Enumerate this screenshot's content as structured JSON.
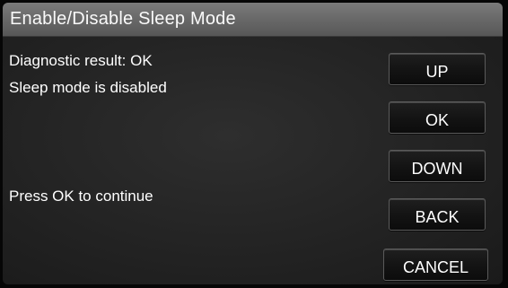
{
  "title": "Enable/Disable Sleep Mode",
  "messages": {
    "line1": "Diagnostic result: OK",
    "line2": "Sleep mode is disabled",
    "prompt": "Press OK to continue"
  },
  "buttons": {
    "up": "UP",
    "ok": "OK",
    "down": "DOWN",
    "back": "BACK",
    "cancel": "CANCEL"
  }
}
